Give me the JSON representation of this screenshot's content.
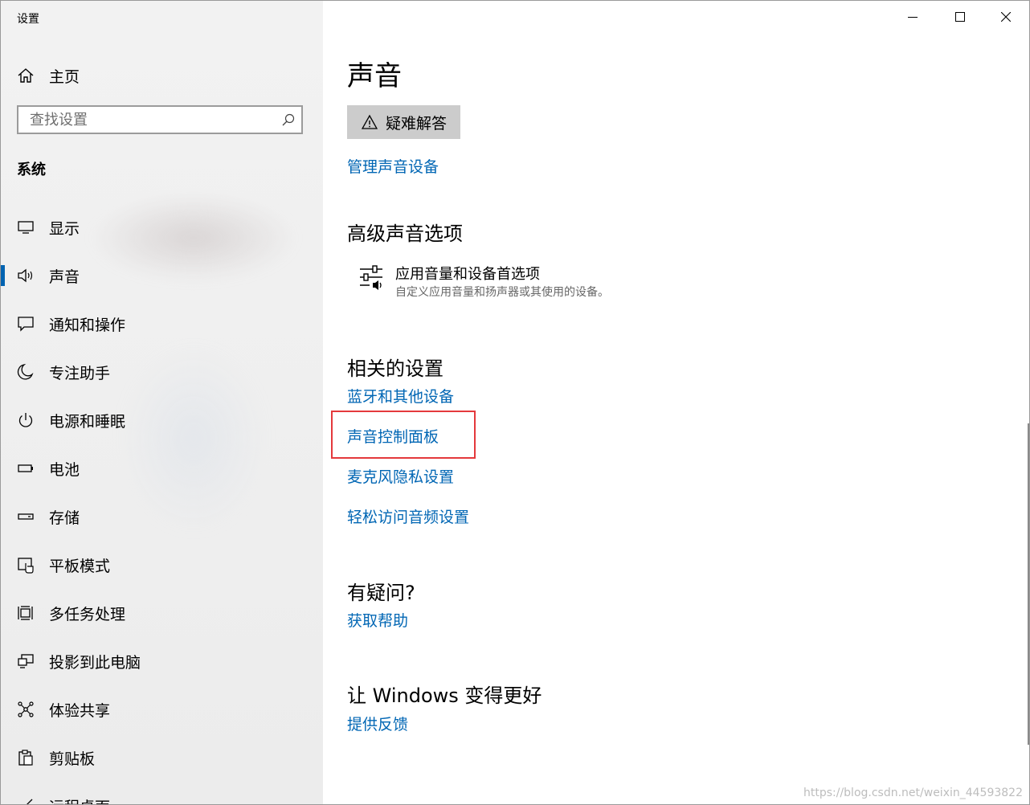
{
  "window": {
    "title": "设置",
    "controls": {
      "minimize": "minimize-icon",
      "maximize": "maximize-icon",
      "close": "close-icon"
    }
  },
  "sidebar": {
    "home_label": "主页",
    "search_placeholder": "查找设置",
    "section_label": "系统",
    "active_index": 1,
    "items": [
      {
        "label": "显示",
        "icon": "monitor-icon"
      },
      {
        "label": "声音",
        "icon": "speaker-icon"
      },
      {
        "label": "通知和操作",
        "icon": "notification-icon"
      },
      {
        "label": "专注助手",
        "icon": "moon-icon"
      },
      {
        "label": "电源和睡眠",
        "icon": "power-icon"
      },
      {
        "label": "电池",
        "icon": "battery-icon"
      },
      {
        "label": "存储",
        "icon": "storage-icon"
      },
      {
        "label": "平板模式",
        "icon": "tablet-mode-icon"
      },
      {
        "label": "多任务处理",
        "icon": "multitasking-icon"
      },
      {
        "label": "投影到此电脑",
        "icon": "project-icon"
      },
      {
        "label": "体验共享",
        "icon": "share-icon"
      },
      {
        "label": "剪贴板",
        "icon": "clipboard-icon"
      },
      {
        "label": "远程桌面",
        "icon": "remote-desktop-icon"
      }
    ]
  },
  "main": {
    "title": "声音",
    "troubleshoot_label": "疑难解答",
    "manage_devices_link": "管理声音设备",
    "advanced": {
      "heading": "高级声音选项",
      "item_title": "应用音量和设备首选项",
      "item_desc": "自定义应用音量和扬声器或其使用的设备。"
    },
    "related": {
      "heading": "相关的设置",
      "links": [
        "蓝牙和其他设备",
        "声音控制面板",
        "麦克风隐私设置",
        "轻松访问音频设置"
      ]
    },
    "help": {
      "heading": "有疑问?",
      "link": "获取帮助"
    },
    "feedback": {
      "heading": "让 Windows 变得更好",
      "link": "提供反馈"
    },
    "watermark": "https://blog.csdn.net/weixin_44593822"
  },
  "colors": {
    "accent": "#0063b1",
    "link": "#0066b4",
    "highlight_box": "#e4393c",
    "button_bg": "#cccccc"
  }
}
